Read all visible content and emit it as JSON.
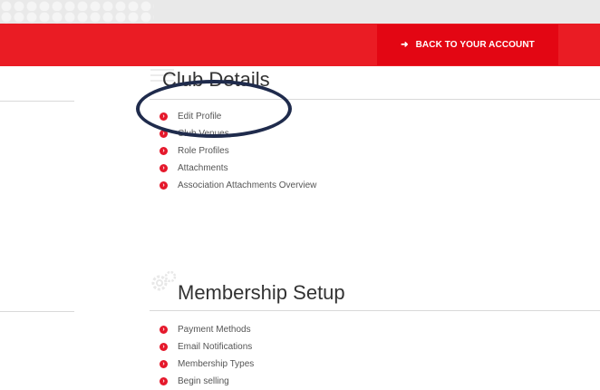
{
  "header": {
    "back_button_label": "BACK TO YOUR ACCOUNT",
    "back_button_icon": "sign-in-icon"
  },
  "sections": {
    "club_details": {
      "title": "Club Details",
      "icon": "list-icon",
      "links": [
        "Edit Profile",
        "Club Venues",
        "Role Profiles",
        "Attachments",
        "Association Attachments Overview"
      ]
    },
    "membership_setup": {
      "title": "Membership Setup",
      "icon": "gears-icon",
      "links": [
        "Payment Methods",
        "Email Notifications",
        "Membership Types",
        "Begin selling"
      ]
    }
  },
  "colors": {
    "brand_red": "#ea1c24",
    "bullet_red": "#e5182b",
    "annotation_navy": "#1f2b4c"
  }
}
